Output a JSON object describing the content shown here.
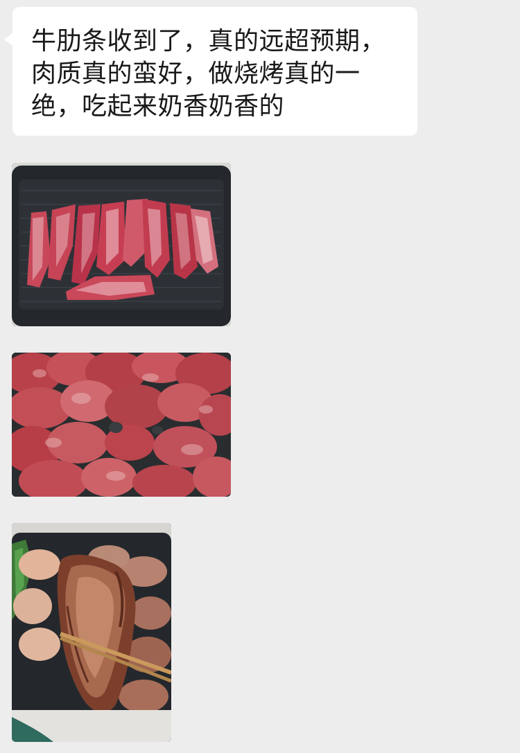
{
  "chat": {
    "messages": [
      {
        "type": "text",
        "text": "牛肋条收到了，真的远超预期，\n肉质真的蛮好，做烧烤真的一\n绝，吃起来奶香奶香的"
      },
      {
        "type": "image",
        "subject": "raw-rib-strips-on-grill-pan"
      },
      {
        "type": "image",
        "subject": "cut-raw-beef-pieces"
      },
      {
        "type": "image",
        "subject": "grilled-beef-held-with-chopsticks"
      }
    ]
  },
  "colors": {
    "chat_background": "#ededed",
    "bubble_background": "#ffffff",
    "text": "#191919"
  }
}
